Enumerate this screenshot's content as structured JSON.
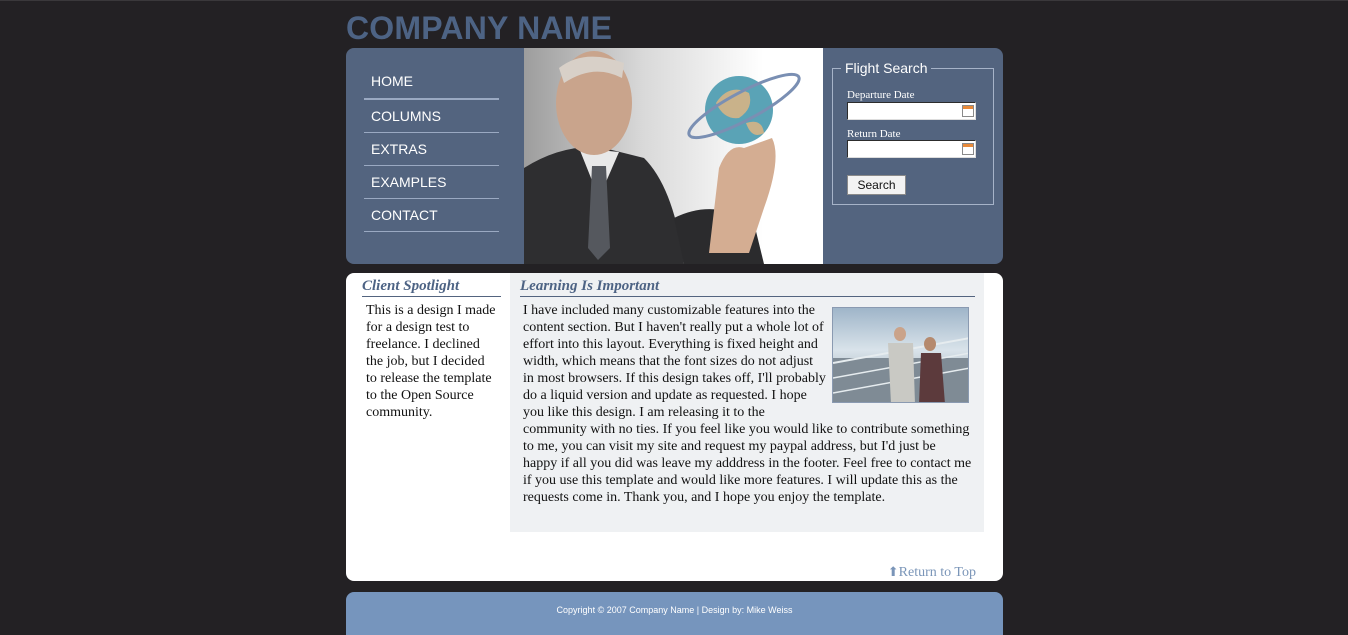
{
  "header": {
    "company_name": "COMPANY NAME"
  },
  "nav": {
    "items": [
      {
        "label": "HOME"
      },
      {
        "label": "COLUMNS"
      },
      {
        "label": "EXTRAS"
      },
      {
        "label": "EXAMPLES"
      },
      {
        "label": "CONTACT"
      }
    ]
  },
  "flight_search": {
    "legend": "Flight Search",
    "departure_label": "Departure Date",
    "departure_value": "",
    "return_label": "Return Date",
    "return_value": "",
    "search_label": "Search"
  },
  "sidebar": {
    "heading": "Client Spotlight",
    "text": "This is a design I made for a design test to freelance. I declined the job, but I decided to release the template to the Open Source community."
  },
  "main": {
    "heading": "Learning Is Important",
    "body": "I have included many customizable features into the content section. But I haven't really put a whole lot of effort into this layout. Everything is fixed height and width, which means that the font sizes do not adjust in most browsers. If this design takes off, I'll probably do a liquid version and update as requested. I hope you like this design. I am releasing it to the community with no ties. If you feel like you would like to contribute something to me, you can visit my site and request my paypal address, but I'd just be happy if all you did was leave my adddress in the footer. Feel free to contact me if you use this template and would like more features. I will update this as the requests come in. Thank you, and I hope you enjoy the template.",
    "return_top": "Return to Top"
  },
  "footer": {
    "text": "Copyright © 2007 Company Name | Design by: Mike Weiss"
  },
  "colors": {
    "background": "#232124",
    "header_panel": "#53647f",
    "brand": "#4d6384",
    "footer": "#7695bd",
    "content_bg": "#eff1f3"
  }
}
